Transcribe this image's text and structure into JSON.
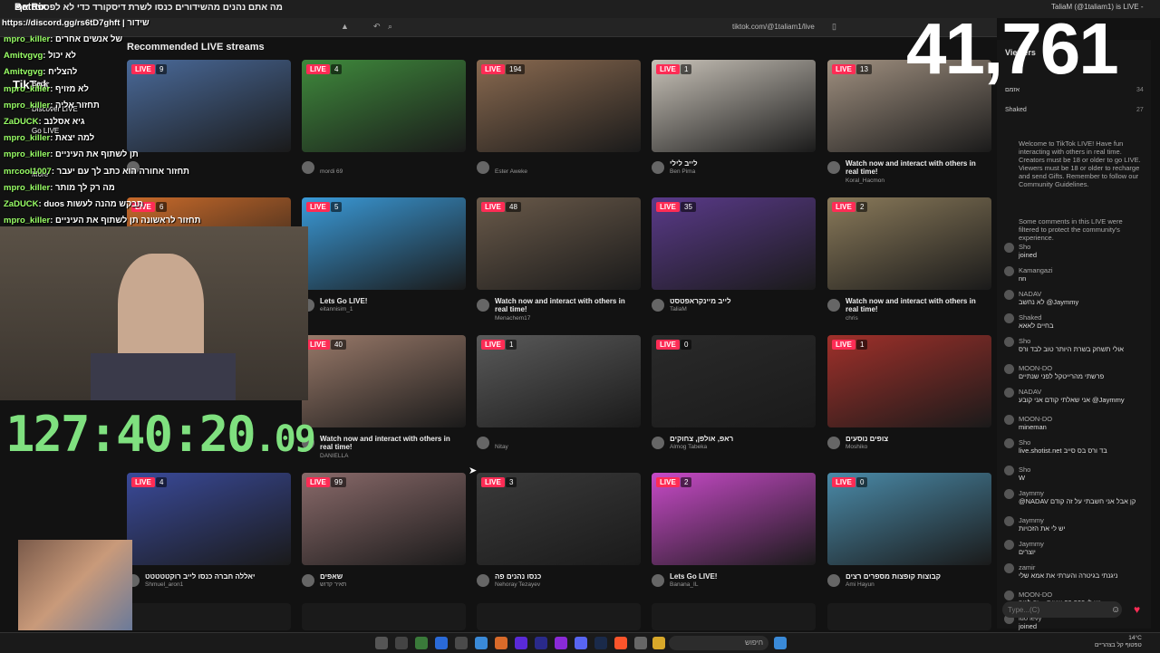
{
  "browser": {
    "tab_title": "מה אתם נהנים מהשידורים כנסו לשרת דיסקורד כדי לא לפספס אף",
    "tab2_title": "TaliaM (@1taliam1) is LIVE -",
    "url": "tiktok.com/@1taliam1/live"
  },
  "overlay": {
    "logo": "TikTok",
    "discord_link": "https://discord.gg/rs6tD7ghft | שידור",
    "bot_name": "BotRix",
    "viewer_counter": "41,761",
    "timer_main": "127:40:20",
    "timer_ms": ".09",
    "chat": [
      {
        "user": "mpro_killer",
        "msg": "של אנשים אחרים"
      },
      {
        "user": "Amitvgvg",
        "msg": "לא יכול"
      },
      {
        "user": "Amitvgvg",
        "msg": "להצליח"
      },
      {
        "user": "mpro_killer",
        "msg": "לא מזויף"
      },
      {
        "user": "mpro_killer",
        "msg": "תחזור אליה"
      },
      {
        "user": "ZaDUCK",
        "msg": "גיא אסלנב"
      },
      {
        "user": "mpro_killer",
        "msg": "למה יצאת"
      },
      {
        "user": "mpro_killer",
        "msg": "תן לשתוף את העיניים"
      },
      {
        "user": "mrcool1007",
        "msg": "תחזור אחורה הוא כתב לך עם יעבר"
      },
      {
        "user": "mpro_killer",
        "msg": "מה רק לך מותר"
      },
      {
        "user": "ZaDUCK",
        "msg": "duos תבקש מהנה לעשות"
      },
      {
        "user": "mpro_killer",
        "msg": "תחזור לראשונה תן לשתוף את העיניים"
      }
    ],
    "side_menu": [
      "Back",
      "Discover LIVE",
      "Go LIVE",
      "More"
    ]
  },
  "main": {
    "section_title": "Recommended LIVE streams",
    "live_label": "LIVE",
    "cards": [
      {
        "viewers": "9",
        "title": "",
        "user": "",
        "color": "#4a6a9a"
      },
      {
        "viewers": "4",
        "title": "",
        "user": "mordi 69",
        "color": "#3f8a3c"
      },
      {
        "viewers": "194",
        "title": "",
        "user": "Ester Aweke",
        "color": "#8a6a50"
      },
      {
        "viewers": "1",
        "title": "לייב לילי",
        "user": "Ben Pima",
        "color": "#c8c2b8"
      },
      {
        "viewers": "13",
        "title": "Watch now and interact with others in real time!",
        "user": "Koral_Hacmon",
        "color": "#a09080"
      },
      {
        "viewers": "6",
        "title": "",
        "user": "",
        "color": "#c86a2a"
      },
      {
        "viewers": "5",
        "title": "Lets Go LIVE!",
        "user": "eitannisim_1",
        "color": "#3a9ad8"
      },
      {
        "viewers": "48",
        "title": "Watch now and interact with others in real time!",
        "user": "Menachem17",
        "color": "#6a5a4a"
      },
      {
        "viewers": "35",
        "title": "לייב מיינקראפטסט",
        "user": "TaliaM",
        "color": "#5a3a8a"
      },
      {
        "viewers": "2",
        "title": "Watch now and interact with others in real time!",
        "user": "chris",
        "color": "#8a7a5a"
      },
      {
        "viewers": "40",
        "title": "Watch now and interact with others in real time!",
        "user": "DANIELLA",
        "color": "#9a7a6a"
      },
      {
        "viewers": "1",
        "title": "",
        "user": "Nitay",
        "color": "#5a5a5a"
      },
      {
        "viewers": "0",
        "title": "ראפ, אולפן, צחוקים",
        "user": "Almog Tabeka",
        "color": "#2a2a2a"
      },
      {
        "viewers": "1",
        "title": "צופים נוסעים",
        "user": "Moshiko",
        "color": "#a0302a"
      },
      {
        "viewers": "4",
        "title": "יאללה חברה כנסו לייב רוקטטטטט",
        "user": "Shmuel_aron1",
        "color": "#3a4a9a"
      },
      {
        "viewers": "99",
        "title": "שאפים",
        "user": "תאיר קדוש",
        "color": "#8a6a6a"
      },
      {
        "viewers": "3",
        "title": "כנסו נהנים פה",
        "user": "Nehoray Tezayev",
        "color": "#3a3a3a"
      },
      {
        "viewers": "2",
        "title": "Lets Go LIVE!",
        "user": "Banana_IL",
        "color": "#c84ac8"
      },
      {
        "viewers": "0",
        "title": "קבוצות קופצות מספרים רצים",
        "user": "Ami Hayun",
        "color": "#4a8aa8"
      }
    ]
  },
  "viewers_panel": {
    "title": "Viewers",
    "list": [
      {
        "name": "אזמם",
        "count": "34"
      },
      {
        "name": "Shaked",
        "count": "27"
      }
    ],
    "welcome": "Welcome to TikTok LIVE! Have fun interacting with others in real time. Creators must be 18 or older to go LIVE. Viewers must be 18 or older to recharge and send Gifts. Remember to follow our Community Guidelines.",
    "filtered": "Some comments in this LIVE were filtered to protect the community's experience.",
    "messages": [
      {
        "user": "Sho",
        "text": "joined"
      },
      {
        "user": "Kamangazi",
        "text": "nn"
      },
      {
        "user": "NADAV",
        "text": "לא נחשב @Jaymmy"
      },
      {
        "user": "Shaked",
        "text": "בחיים לאאא"
      },
      {
        "user": "Sho",
        "text": "אולי תשחק בשרת היותר טוב לבד ורס"
      },
      {
        "user": "MOON-DO",
        "text": "פרשתי מהרייטקל לפני שנתיים"
      },
      {
        "user": "NADAV",
        "text": "אני שאלתי קודם אני קובע @Jaymmy"
      },
      {
        "user": "MOON-DO",
        "text": "mineman"
      },
      {
        "user": "Sho",
        "text": "live.shotist.net בד ורס בס סייב"
      },
      {
        "user": "Sho",
        "text": "W"
      },
      {
        "user": "Jaymmy",
        "text": "@NADAV קן אבל אני חשבתי על זה קודם"
      },
      {
        "user": "Jaymmy",
        "text": "יש לי את הזכויות"
      },
      {
        "user": "Jaymmy",
        "text": "יוצרים"
      },
      {
        "user": "zamir",
        "text": "ניגנתי בגיטרה והערתי את אמא שלי"
      },
      {
        "user": "MOON-DO",
        "text": "יש לי 20,000 שעות... זה למה"
      },
      {
        "user": "ido levy",
        "text": "joined"
      }
    ],
    "input_placeholder": "Type...(C)"
  },
  "taskbar": {
    "search_label": "חיפוש",
    "weather": "14°C",
    "tray_text": "טפטוף קל בצהריים"
  },
  "colors": {
    "accent": "#fe2c55",
    "timer": "#7fe07f"
  }
}
